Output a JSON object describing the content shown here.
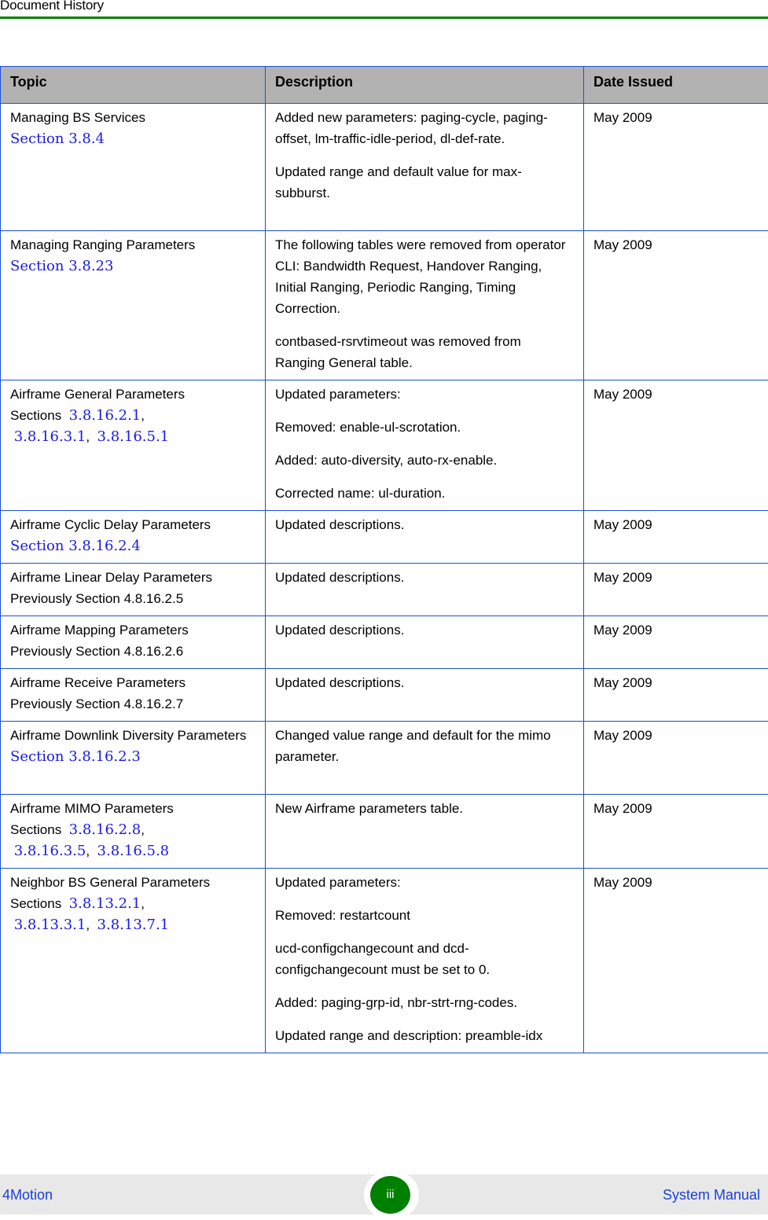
{
  "header": {
    "title": "Document History",
    "accent_color": "#008000"
  },
  "table": {
    "columns": [
      "Topic",
      "Description",
      "Date Issued"
    ],
    "rows": [
      {
        "topic": "Managing BS Services",
        "topic_prefix": "",
        "sections": [
          "Section 3.8.4"
        ],
        "description": [
          "Added new parameters: paging-cycle, paging-offset, lm-traffic-idle-period, dl-def-rate.",
          "Updated range and default value for max-subburst."
        ],
        "date": "May 2009"
      },
      {
        "topic": "Managing Ranging Parameters",
        "topic_prefix": "",
        "sections": [
          "Section 3.8.23"
        ],
        "description": [
          "The following tables were removed from operator CLI: Bandwidth Request, Handover Ranging, Initial Ranging, Periodic Ranging, Timing Correction.",
          "contbased-rsrvtimeout was removed from Ranging General table."
        ],
        "date": "May 2009"
      },
      {
        "topic": "Airframe General Parameters",
        "topic_prefix": "Sections",
        "sections": [
          "3.8.16.2.1",
          "3.8.16.3.1",
          "3.8.16.5.1"
        ],
        "description": [
          "Updated parameters:",
          "Removed: enable-ul-scrotation.",
          "Added: auto-diversity, auto-rx-enable.",
          "Corrected name: ul-duration."
        ],
        "date": "May 2009"
      },
      {
        "topic": "Airframe Cyclic Delay Parameters",
        "topic_prefix": "",
        "sections": [
          "Section 3.8.16.2.4"
        ],
        "description": [
          "Updated descriptions."
        ],
        "date": "May 2009"
      },
      {
        "topic": "Airframe Linear Delay Parameters",
        "topic_prefix": "",
        "note": "Previously Section 4.8.16.2.5",
        "sections": [],
        "description": [
          "Updated descriptions."
        ],
        "date": "May 2009"
      },
      {
        "topic": "Airframe Mapping Parameters",
        "topic_prefix": "",
        "note": "Previously Section 4.8.16.2.6",
        "sections": [],
        "description": [
          "Updated descriptions."
        ],
        "date": "May 2009"
      },
      {
        "topic": "Airframe Receive Parameters",
        "topic_prefix": "",
        "note": "Previously Section 4.8.16.2.7",
        "sections": [],
        "description": [
          "Updated descriptions."
        ],
        "date": "May 2009"
      },
      {
        "topic": "Airframe Downlink Diversity Parameters",
        "topic_prefix": "",
        "sections": [
          "Section 3.8.16.2.3"
        ],
        "description": [
          "Changed value range and default for the mimo parameter."
        ],
        "date": "May 2009"
      },
      {
        "topic": "Airframe MIMO Parameters",
        "topic_prefix": "Sections",
        "sections": [
          "3.8.16.2.8",
          "3.8.16.3.5",
          "3.8.16.5.8"
        ],
        "description": [
          "New Airframe parameters table."
        ],
        "date": "May 2009"
      },
      {
        "topic": "Neighbor BS General Parameters",
        "topic_prefix": "Sections",
        "sections": [
          "3.8.13.2.1",
          "3.8.13.3.1",
          "3.8.13.7.1"
        ],
        "description": [
          "Updated parameters:",
          "Removed: restartcount",
          "ucd-configchangecount and dcd-configchangecount must be set to 0.",
          "Added: paging-grp-id, nbr-strt-rng-codes.",
          "Updated range and description: preamble-idx"
        ],
        "date": "May 2009"
      }
    ]
  },
  "footer": {
    "product": "4Motion",
    "page_number": "iii",
    "document": "System Manual"
  }
}
